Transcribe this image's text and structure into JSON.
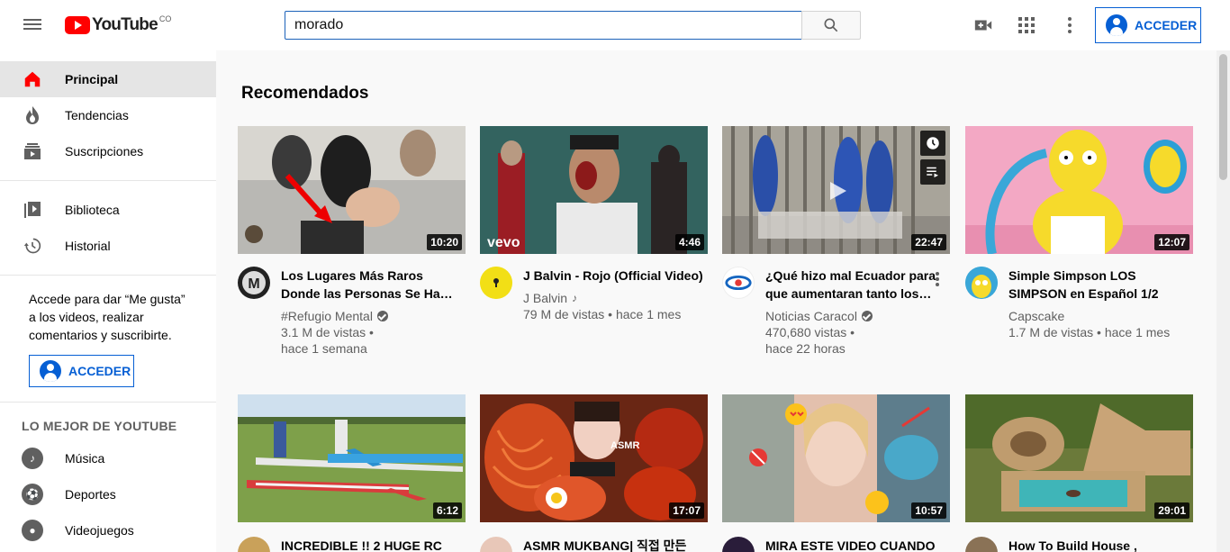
{
  "header": {
    "logo_text": "YouTube",
    "country": "CO",
    "search_value": "morado",
    "signin_label": "ACCEDER"
  },
  "sidebar": {
    "items_main": [
      {
        "label": "Principal",
        "icon": "home-icon"
      },
      {
        "label": "Tendencias",
        "icon": "trending-icon"
      },
      {
        "label": "Suscripciones",
        "icon": "subscriptions-icon"
      }
    ],
    "items_library": [
      {
        "label": "Biblioteca",
        "icon": "library-icon"
      },
      {
        "label": "Historial",
        "icon": "history-icon"
      }
    ],
    "signin_message": "Accede para dar “Me gusta” a los videos, realizar comentarios y suscribirte.",
    "signin_label": "ACCEDER",
    "best_heading": "LO MEJOR DE YOUTUBE",
    "items_best": [
      {
        "label": "Música",
        "icon": "music-icon"
      },
      {
        "label": "Deportes",
        "icon": "sports-icon"
      },
      {
        "label": "Videojuegos",
        "icon": "gaming-icon"
      }
    ]
  },
  "content": {
    "section_title": "Recomendados",
    "videos": [
      {
        "title": "Los Lugares Más Raros Donde las Personas Se Ha…",
        "channel": "#Refugio Mental",
        "views": "3.1 M de vistas •",
        "age": "hace 1 semana",
        "duration": "10:20"
      },
      {
        "title": "J Balvin - Rojo (Official Video)",
        "channel": "J Balvin",
        "views": "79 M de vistas • hace 1 mes",
        "age": "",
        "duration": "4:46"
      },
      {
        "title": "¿Qué hizo mal Ecuador para que aumentaran tanto los…",
        "channel": "Noticias Caracol",
        "views": "470,680 vistas •",
        "age": "hace 22 horas",
        "duration": "22:47"
      },
      {
        "title": "Simple Simpson LOS SIMPSON en Español 1/2",
        "channel": "Capscake",
        "views": "1.7 M de vistas • hace 1 mes",
        "age": "",
        "duration": "12:07"
      }
    ],
    "videos_row2": [
      {
        "title": "INCREDIBLE !! 2 HUGE RC",
        "duration": "6:12"
      },
      {
        "title": "ASMR MUKBANG| 직접 만든",
        "duration": "17:07"
      },
      {
        "title": "MIRA ESTE VIDEO CUANDO",
        "duration": "10:57"
      },
      {
        "title": "How To Build House ,",
        "duration": "29:01"
      }
    ]
  }
}
